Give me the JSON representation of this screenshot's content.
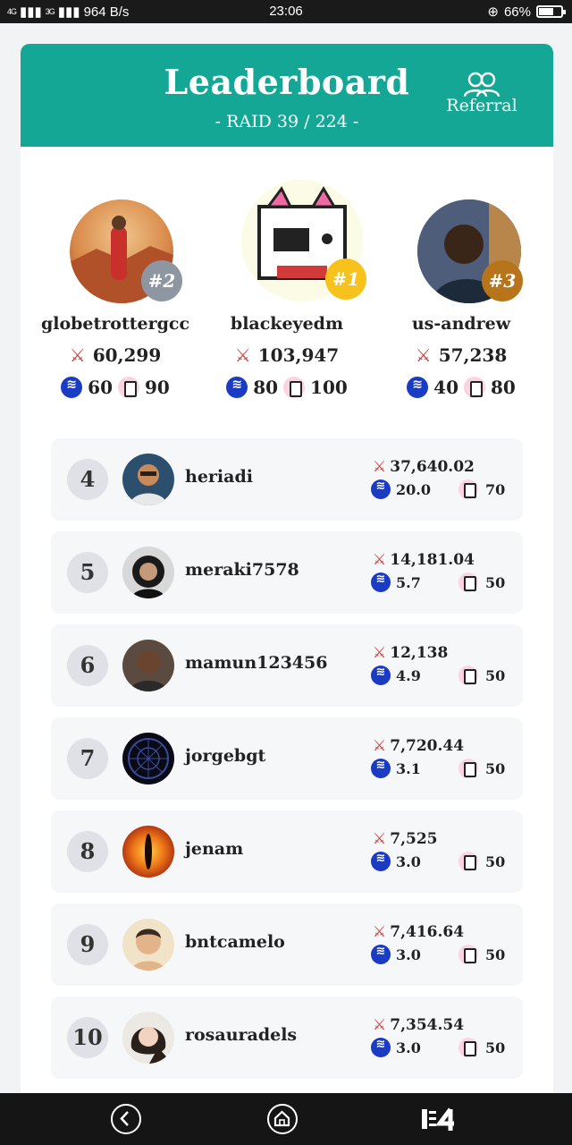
{
  "status_bar": {
    "net_label": "4G",
    "net_label2": "3G",
    "speed": "964 B/s",
    "time": "23:06",
    "battery": "66%",
    "battery_level": 0.66
  },
  "header": {
    "title": "Leaderboard",
    "subtitle": "- RAID 39 / 224 -",
    "referral_label": "Referral",
    "accent_color": "#14a795"
  },
  "podium": [
    {
      "rank": "#2",
      "username": "globetrottergcc",
      "power": "60,299",
      "steem": "60",
      "pixel": "90",
      "badge_color": "#8e96a1"
    },
    {
      "rank": "#1",
      "username": "blackeyedm",
      "power": "103,947",
      "steem": "80",
      "pixel": "100",
      "badge_color": "#f6c21b"
    },
    {
      "rank": "#3",
      "username": "us-andrew",
      "power": "57,238",
      "steem": "40",
      "pixel": "80",
      "badge_color": "#b8741a"
    }
  ],
  "rows": [
    {
      "rank": "4",
      "username": "heriadi",
      "power": "37,640.02",
      "steem": "20.0",
      "pixel": "70"
    },
    {
      "rank": "5",
      "username": "meraki7578",
      "power": "14,181.04",
      "steem": "5.7",
      "pixel": "50"
    },
    {
      "rank": "6",
      "username": "mamun123456",
      "power": "12,138",
      "steem": "4.9",
      "pixel": "50"
    },
    {
      "rank": "7",
      "username": "jorgebgt",
      "power": "7,720.44",
      "steem": "3.1",
      "pixel": "50"
    },
    {
      "rank": "8",
      "username": "jenam",
      "power": "7,525",
      "steem": "3.0",
      "pixel": "50"
    },
    {
      "rank": "9",
      "username": "bntcamelo",
      "power": "7,416.64",
      "steem": "3.0",
      "pixel": "50"
    },
    {
      "rank": "10",
      "username": "rosauradels",
      "power": "7,354.54",
      "steem": "3.0",
      "pixel": "50"
    }
  ],
  "icons": {
    "power": "crossed-swords-icon",
    "steem": "steem-token-icon",
    "pixel": "pixel-token-icon",
    "referral": "users-icon",
    "nav_back": "back-icon",
    "nav_home": "home-icon",
    "nav_menu": "menu-icon"
  }
}
